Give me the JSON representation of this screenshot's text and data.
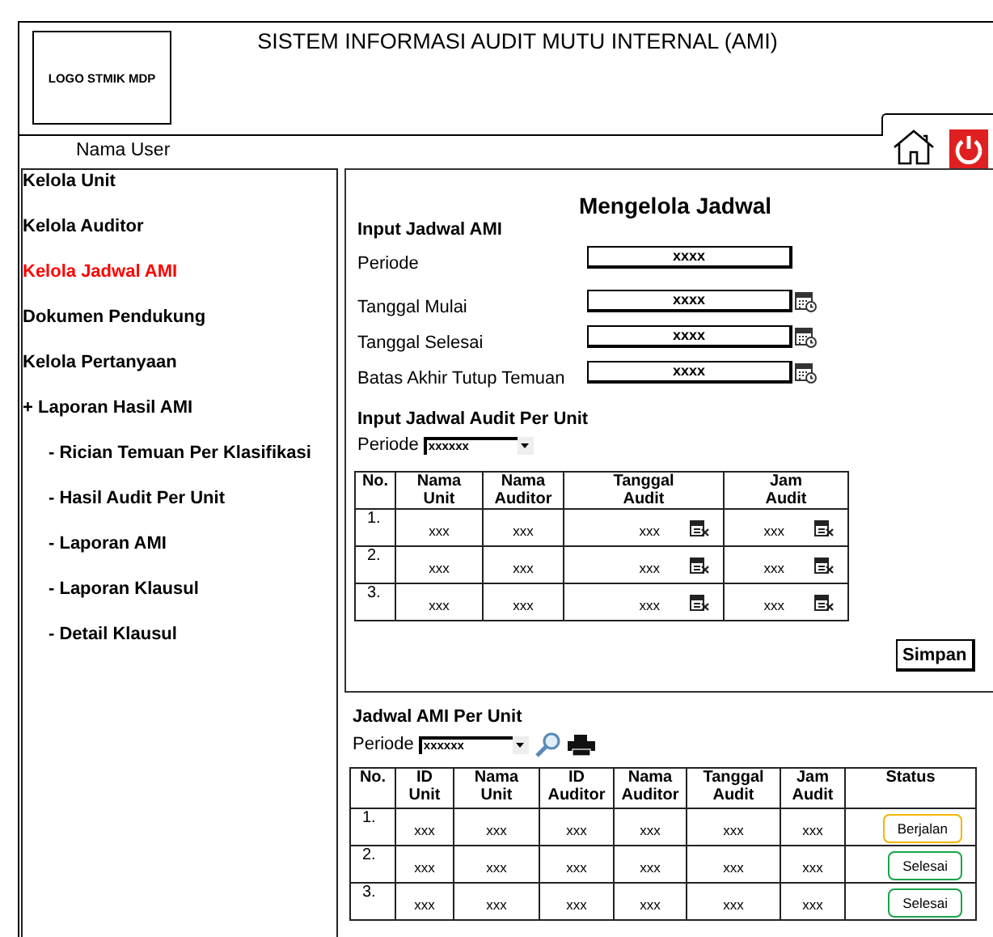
{
  "header": {
    "logo": "LOGO STMIK MDP",
    "title": "SISTEM INFORMASI AUDIT MUTU INTERNAL (AMI)"
  },
  "user": "Nama User",
  "sidebar": {
    "items": [
      {
        "label": "Kelola Unit",
        "selected": false
      },
      {
        "label": "Kelola Auditor",
        "selected": false
      },
      {
        "label": "Kelola Jadwal AMI",
        "selected": true
      },
      {
        "label": "Dokumen Pendukung",
        "selected": false
      },
      {
        "label": "Kelola Pertanyaan",
        "selected": false
      },
      {
        "label": "+ Laporan Hasil AMI",
        "selected": false,
        "children": [
          {
            "label": "- Rician Temuan Per Klasifikasi",
            "selected": false
          },
          {
            "label": "- Hasil Audit Per Unit",
            "selected": false
          },
          {
            "label": "- Laporan AMI",
            "selected": false
          },
          {
            "label": "- Laporan Klausul",
            "selected": false
          },
          {
            "label": "- Detail Klausul",
            "selected": false
          }
        ]
      }
    ]
  },
  "form_panel": {
    "title": "Mengelola Jadwal",
    "section": "Input Jadwal AMI",
    "fields": [
      {
        "label": "Periode",
        "value": "xxxx",
        "kind": "text"
      },
      {
        "label": "Tanggal Mulai",
        "value": "xxxx",
        "kind": "date"
      },
      {
        "label": "Tanggal Selesai",
        "value": "xxxx",
        "kind": "date"
      },
      {
        "label": "Batas Akhir Tutup Temuan",
        "value": "xxxx",
        "kind": "date"
      }
    ],
    "unit_section": "Input Jadwal Audit Per Unit",
    "period": {
      "label": "Periode",
      "value": "xxxxxx"
    },
    "table": {
      "columns": [
        "No.",
        "Nama Unit",
        "Nama Auditor",
        "Tanggal Audit",
        "Jam Audit"
      ],
      "rows": [
        [
          "1.",
          "xxx",
          "xxx",
          "xxx",
          "xxx"
        ],
        [
          "2.",
          "xxx",
          "xxx",
          "xxx",
          "xxx"
        ],
        [
          "3.",
          "xxx",
          "xxx",
          "xxx",
          "xxx"
        ]
      ]
    },
    "save_button": "Simpan"
  },
  "schedule": {
    "title": "Jadwal AMI Per Unit",
    "period": {
      "label": "Periode",
      "value": "xxxxxx"
    },
    "table": {
      "columns": [
        "No.",
        "ID Unit",
        "Nama Unit",
        "ID Auditor",
        "Nama Auditor",
        "Tanggal Audit",
        "Jam Audit",
        "Status"
      ],
      "rows": [
        {
          "cells": [
            "1.",
            "xxx",
            "xxx",
            "xxx",
            "xxx",
            "xxx",
            "xxx"
          ],
          "status": {
            "label": "Berjalan",
            "color": "#f5b400"
          }
        },
        {
          "cells": [
            "2.",
            "xxx",
            "xxx",
            "xxx",
            "xxx",
            "xxx",
            "xxx"
          ],
          "status": {
            "label": "Selesai",
            "color": "#1aa34a"
          }
        },
        {
          "cells": [
            "3.",
            "xxx",
            "xxx",
            "xxx",
            "xxx",
            "xxx",
            "xxx"
          ],
          "status": {
            "label": "Selesai",
            "color": "#1aa34a"
          }
        }
      ]
    }
  }
}
